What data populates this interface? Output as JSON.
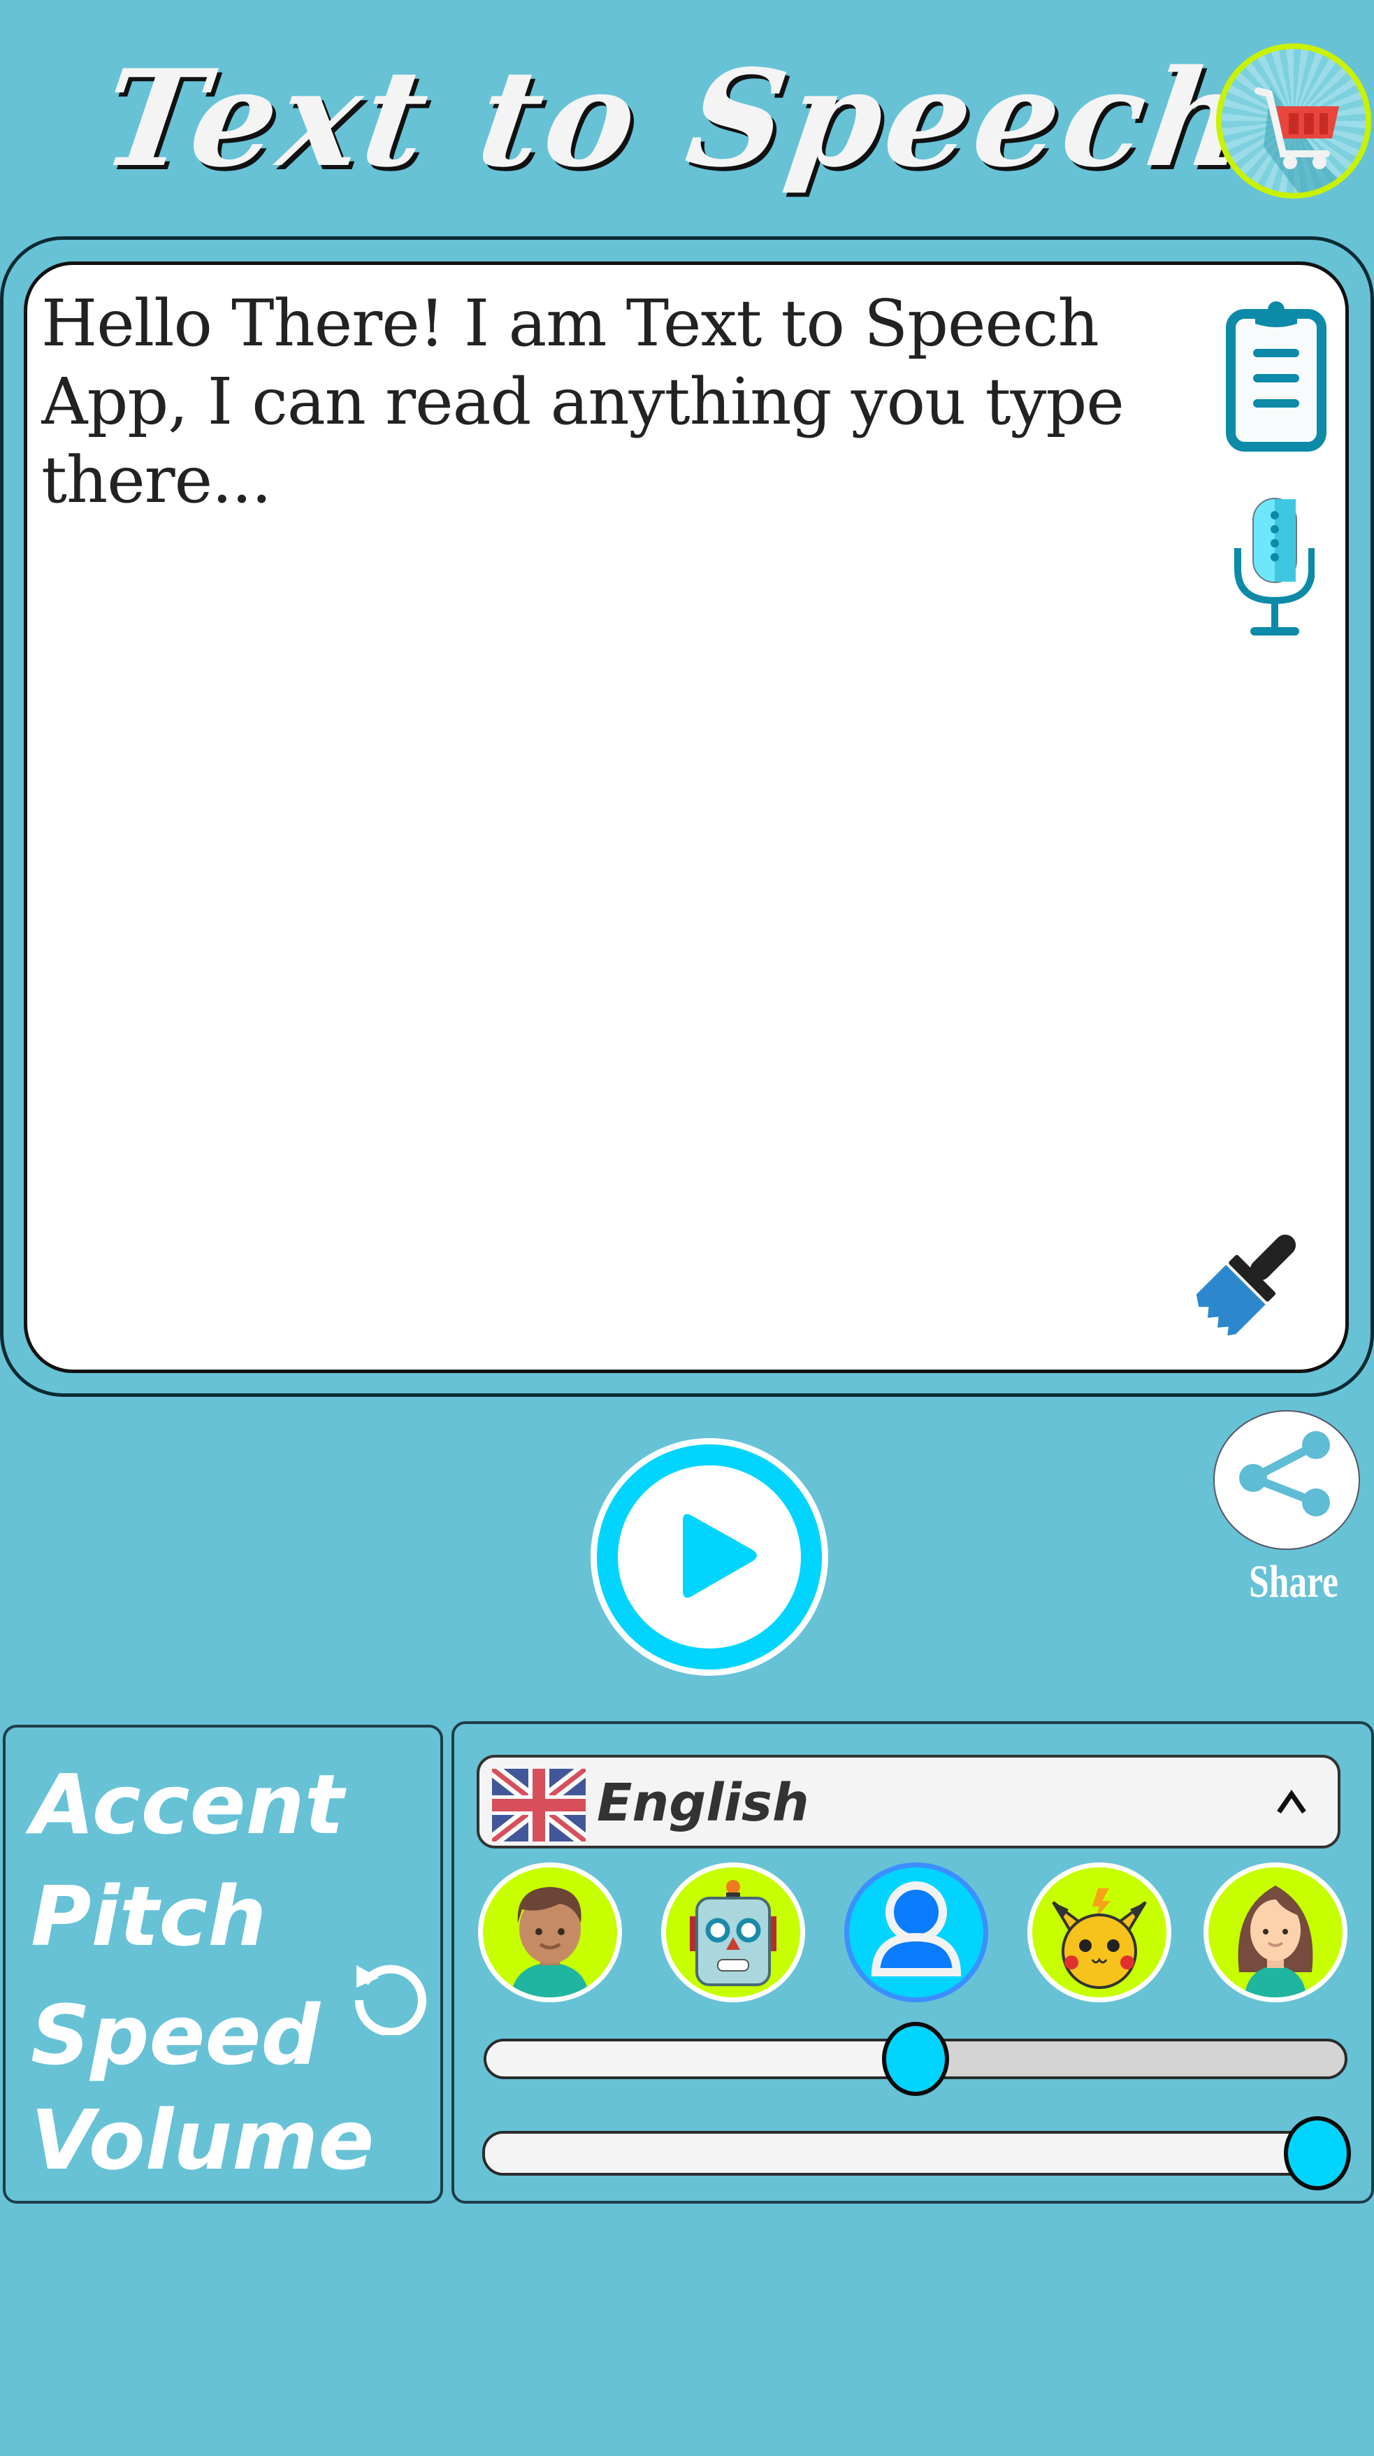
{
  "header": {
    "title": "Text to Speech",
    "cart_icon": "shopping-cart-icon"
  },
  "editor": {
    "text": "Hello There! I am Text to Speech App, I can read anything you type there...",
    "paste_icon": "clipboard-icon",
    "mic_icon": "microphone-icon",
    "clear_icon": "paintbrush-icon"
  },
  "playback": {
    "play_icon": "play-icon",
    "share_icon": "share-icon",
    "share_label": "Share"
  },
  "settings": {
    "labels": [
      "Accent",
      "Pitch",
      "Speed",
      "Volume"
    ],
    "reset_icon": "reset-icon",
    "language": {
      "selected": "English",
      "flag": "uk-flag-icon",
      "chevron": "chevron-up-icon"
    },
    "voices": [
      {
        "name": "boy",
        "icon": "boy-avatar-icon",
        "selected": false
      },
      {
        "name": "robot",
        "icon": "robot-avatar-icon",
        "selected": false
      },
      {
        "name": "default",
        "icon": "person-avatar-icon",
        "selected": true
      },
      {
        "name": "pikachu",
        "icon": "pikachu-avatar-icon",
        "selected": false
      },
      {
        "name": "girl",
        "icon": "girl-avatar-icon",
        "selected": false
      }
    ],
    "sliders": [
      {
        "name": "speed",
        "value_percent": 50
      },
      {
        "name": "volume",
        "value_percent": 100
      }
    ]
  },
  "colors": {
    "background": "#67c2d6",
    "accent_cyan": "#00d4ff",
    "lime": "#c8ff00",
    "icon_teal": "#0d8aa8"
  }
}
